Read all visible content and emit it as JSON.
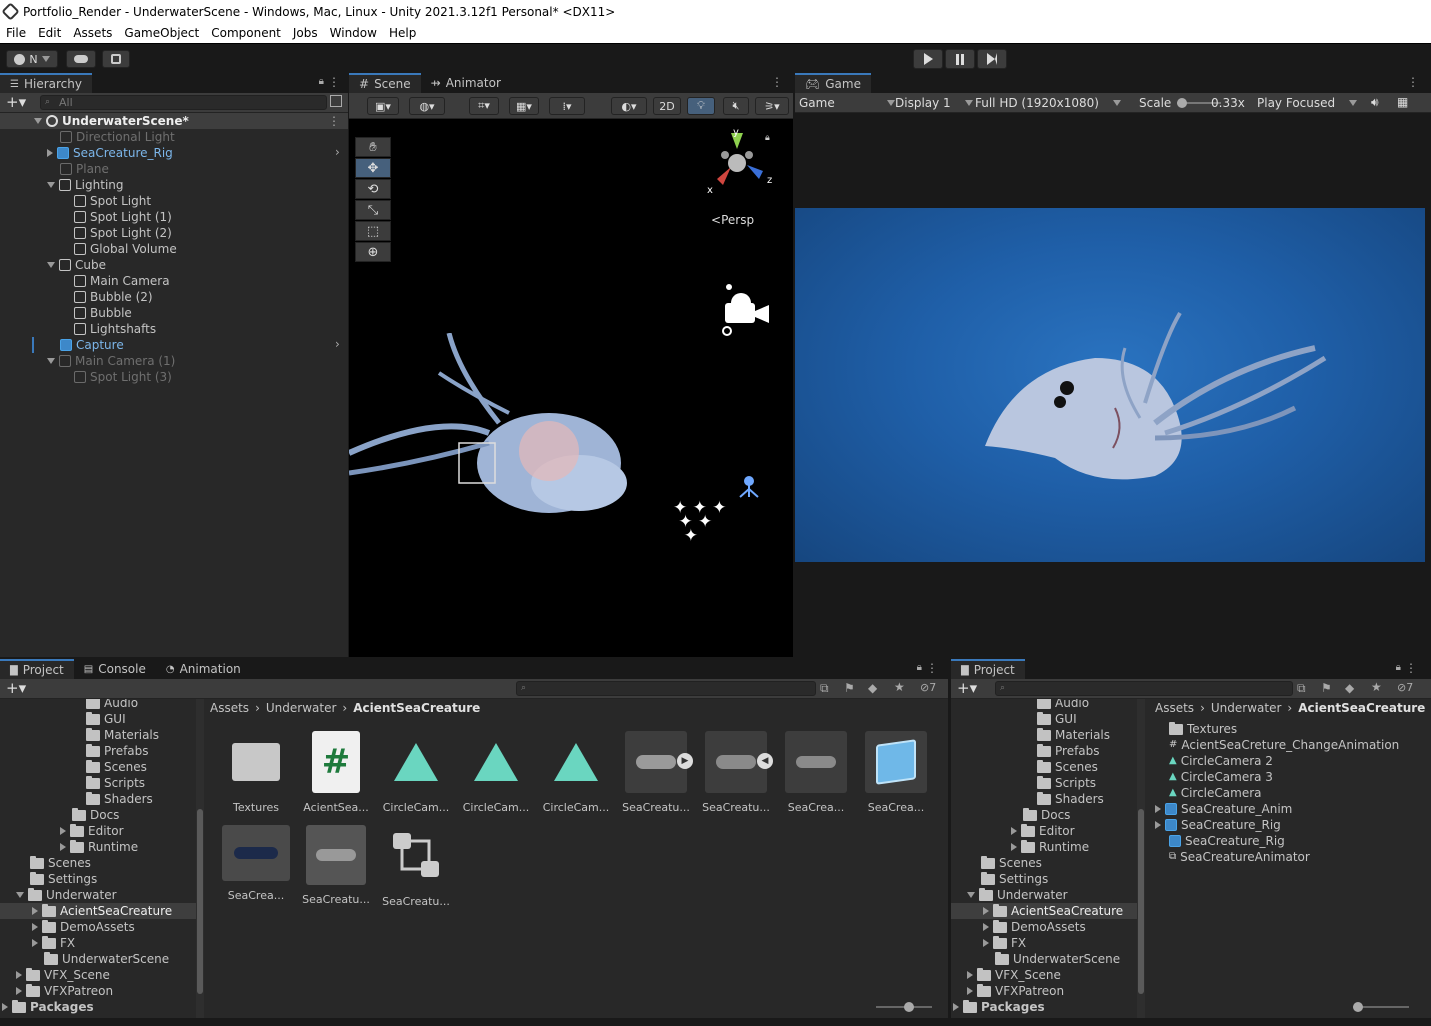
{
  "window": {
    "title": "Portfolio_Render - UnderwaterScene - Windows, Mac, Linux - Unity 2021.3.12f1 Personal* <DX11>"
  },
  "menu": [
    "File",
    "Edit",
    "Assets",
    "GameObject",
    "Component",
    "Jobs",
    "Window",
    "Help"
  ],
  "toolbar": {
    "account_label": "N"
  },
  "hierarchy": {
    "tab": "Hierarchy",
    "search_placeholder": "All",
    "scene": "UnderwaterScene*",
    "items": [
      {
        "label": "Directional Light",
        "state": "dim"
      },
      {
        "label": "SeaCreature_Rig",
        "state": "prefab"
      },
      {
        "label": "Plane",
        "state": "dim"
      },
      {
        "label": "Lighting",
        "state": "normal"
      },
      {
        "label": "Spot Light",
        "state": "normal"
      },
      {
        "label": "Spot Light (1)",
        "state": "normal"
      },
      {
        "label": "Spot Light (2)",
        "state": "normal"
      },
      {
        "label": "Global Volume",
        "state": "normal"
      },
      {
        "label": "Cube",
        "state": "normal"
      },
      {
        "label": "Main Camera",
        "state": "normal"
      },
      {
        "label": "Bubble (2)",
        "state": "normal"
      },
      {
        "label": "Bubble",
        "state": "normal"
      },
      {
        "label": "Lightshafts",
        "state": "normal"
      },
      {
        "label": "Capture",
        "state": "prefab"
      },
      {
        "label": "Main Camera (1)",
        "state": "dim"
      },
      {
        "label": "Spot Light (3)",
        "state": "dim"
      }
    ]
  },
  "scene_view": {
    "tabs": [
      "Scene",
      "Animator"
    ],
    "mode_2d": "2D",
    "projection": "Persp",
    "axes": [
      "y",
      "x",
      "z"
    ]
  },
  "game_view": {
    "tab": "Game",
    "view": "Game",
    "display": "Display 1",
    "resolution": "Full HD (1920x1080)",
    "scale_label": "Scale",
    "scale_value": "0.33x",
    "play_mode": "Play Focused"
  },
  "project_left": {
    "tabs": [
      "Project",
      "Console",
      "Animation"
    ],
    "hidden_count": "7",
    "breadcrumb": [
      "Assets",
      "Underwater",
      "AcientSeaCreature"
    ],
    "tree": [
      "Audio",
      "GUI",
      "Materials",
      "Prefabs",
      "Scenes",
      "Scripts",
      "Shaders",
      "Docs",
      "Editor",
      "Runtime",
      "Scenes",
      "Settings",
      "Underwater",
      "AcientSeaCreature",
      "DemoAssets",
      "FX",
      "UnderwaterScene",
      "VFX_Scene",
      "VFXPatreon",
      "Packages"
    ],
    "assets": [
      "Textures",
      "AcientSea...",
      "CircleCam...",
      "CircleCam...",
      "CircleCam...",
      "SeaCreatu...",
      "SeaCreatu...",
      "SeaCrea...",
      "SeaCrea...",
      "SeaCrea...",
      "SeaCreatu...",
      "SeaCreatu..."
    ]
  },
  "project_right": {
    "tab": "Project",
    "hidden_count": "7",
    "breadcrumb": [
      "Assets",
      "Underwater",
      "AcientSeaCreature"
    ],
    "tree": [
      "Audio",
      "GUI",
      "Materials",
      "Prefabs",
      "Scenes",
      "Scripts",
      "Shaders",
      "Docs",
      "Editor",
      "Runtime",
      "Scenes",
      "Settings",
      "Underwater",
      "AcientSeaCreature",
      "DemoAssets",
      "FX",
      "UnderwaterScene",
      "VFX_Scene",
      "VFXPatreon",
      "Packages"
    ],
    "list": [
      "Textures",
      "AcientSeaCreture_ChangeAnimation",
      "CircleCamera 2",
      "CircleCamera 3",
      "CircleCamera",
      "SeaCreature_Anim",
      "SeaCreature_Rig",
      "SeaCreature_Rig",
      "SeaCreatureAnimator"
    ]
  },
  "colors": {
    "accent": "#3a79bb",
    "panel": "#282828",
    "game_bg": "#1f5fa8",
    "selection": "#2c5d87"
  }
}
